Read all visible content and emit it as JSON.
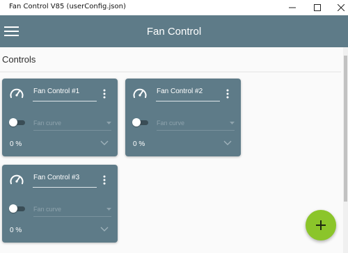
{
  "window": {
    "title": "Fan Control V85 (userConfig.json)",
    "controls": [
      "minimize-icon",
      "maximize-icon",
      "close-icon"
    ]
  },
  "appbar": {
    "title": "Fan Control",
    "menu_icon": "hamburger-menu-icon",
    "color": "#5e7b88"
  },
  "section": {
    "title": "Controls"
  },
  "cards": [
    {
      "name": "Fan Control #1",
      "curve_placeholder": "Fan curve",
      "speed": "0 %",
      "enabled": false
    },
    {
      "name": "Fan Control #2",
      "curve_placeholder": "Fan curve",
      "speed": "0 %",
      "enabled": false
    },
    {
      "name": "Fan Control #3",
      "curve_placeholder": "Fan curve",
      "speed": "0 %",
      "enabled": false
    }
  ],
  "fab": {
    "icon": "plus-icon",
    "color": "#8bc52a"
  }
}
